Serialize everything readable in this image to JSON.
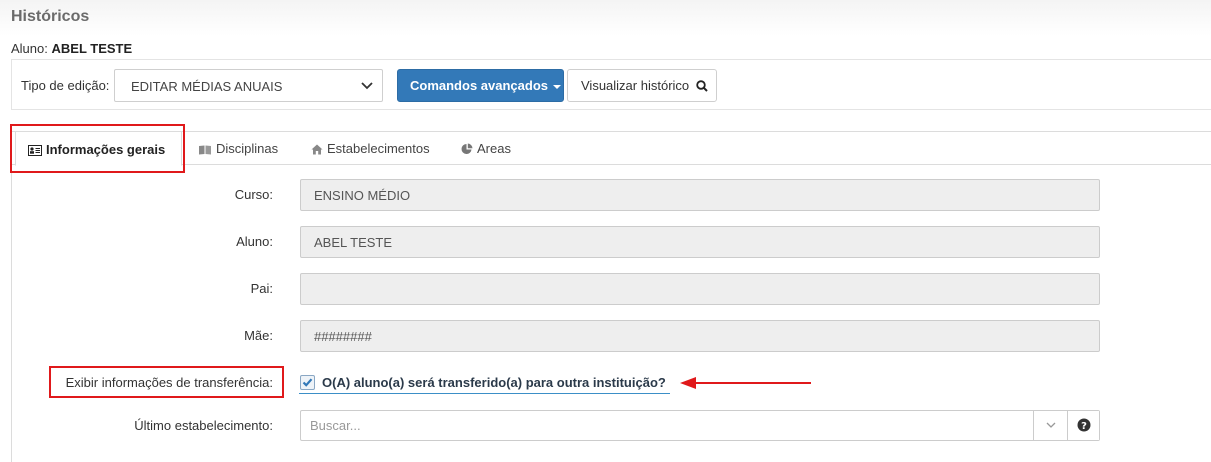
{
  "page": {
    "title": "Históricos"
  },
  "student": {
    "label": "Aluno:",
    "name": "ABEL TESTE"
  },
  "toolbar": {
    "edit_type_label": "Tipo de edição:",
    "edit_type_value": "EDITAR MÉDIAS ANUAIS",
    "advanced_commands_label": "Comandos avançados",
    "view_history_label": "Visualizar histórico"
  },
  "tabs": [
    {
      "label": "Informações gerais",
      "icon": "id-card-icon",
      "active": true
    },
    {
      "label": "Disciplinas",
      "icon": "book-icon",
      "active": false
    },
    {
      "label": "Estabelecimentos",
      "icon": "home-icon",
      "active": false
    },
    {
      "label": "Areas",
      "icon": "pie-chart-icon",
      "active": false
    }
  ],
  "form": {
    "course_label": "Curso:",
    "course_value": "ENSINO MÉDIO",
    "student_label": "Aluno:",
    "student_value": "ABEL TESTE",
    "father_label": "Pai:",
    "father_value": "",
    "mother_label": "Mãe:",
    "mother_value": "########",
    "transfer_label": "Exibir informações de transferência:",
    "transfer_checkbox_label": "O(A) aluno(a) será transferido(a) para outra instituição?",
    "transfer_checked": true,
    "last_establishment_label": "Último estabelecimento:",
    "last_establishment_placeholder": "Buscar..."
  },
  "colors": {
    "primary": "#3379b8",
    "highlight": "#e0191b",
    "check": "#3379b8"
  }
}
